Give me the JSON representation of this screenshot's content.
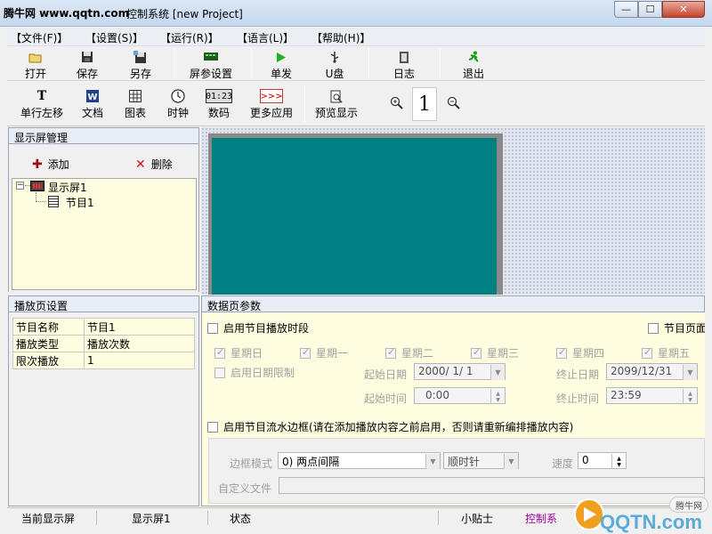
{
  "window": {
    "brand": "腾牛网 www.qqtn.com",
    "title": "控制系统 [new Project]",
    "min_symbol": "—",
    "max_symbol": "☐",
    "close_symbol": "✕"
  },
  "menu": [
    {
      "label": "【文件(F)】"
    },
    {
      "label": "【设置(S)】"
    },
    {
      "label": "【运行(R)】"
    },
    {
      "label": "【语言(L)】"
    },
    {
      "label": "【帮助(H)】"
    }
  ],
  "toolbar1": [
    {
      "label": "打开",
      "icon": "folder-open-icon"
    },
    {
      "label": "保存",
      "icon": "floppy-disk-icon"
    },
    {
      "label": "另存",
      "icon": "save-as-icon"
    },
    {
      "label": "屏参设置",
      "icon": "screen-settings-icon"
    },
    {
      "label": "单发",
      "icon": "play-icon"
    },
    {
      "label": "U盘",
      "icon": "usb-icon"
    },
    {
      "label": "日志",
      "icon": "log-icon"
    },
    {
      "label": "退出",
      "icon": "exit-runner-icon"
    }
  ],
  "toolbar2": [
    {
      "label": "单行左移",
      "icon": "text-t-icon"
    },
    {
      "label": "文档",
      "icon": "word-doc-icon"
    },
    {
      "label": "图表",
      "icon": "table-icon"
    },
    {
      "label": "时钟",
      "icon": "clock-icon"
    },
    {
      "label": "数码",
      "icon": "digital-01-23-icon"
    },
    {
      "label": "更多应用",
      "icon": "more-arrows-icon"
    },
    {
      "label": "预览显示",
      "icon": "preview-icon"
    }
  ],
  "zoom": {
    "value": "1"
  },
  "screen_mgr": {
    "title": "显示屏管理",
    "add_label": "添加",
    "delete_label": "删除",
    "tree_root": "显示屏1",
    "tree_child": "节目1"
  },
  "play_page": {
    "title": "播放页设置",
    "rows": [
      {
        "key": "节目名称",
        "value": "节目1"
      },
      {
        "key": "播放类型",
        "value": "播放次数"
      },
      {
        "key": "限次播放",
        "value": "1"
      }
    ]
  },
  "data_page": {
    "title": "数据页参数",
    "enable_period": "启用节目播放时段",
    "page_flip": "节目页面",
    "weekdays": [
      "星期日",
      "星期一",
      "星期二",
      "星期三",
      "星期四",
      "星期五"
    ],
    "enable_date_limit": "启用日期限制",
    "start_date_label": "起始日期",
    "start_date": "2000/ 1/ 1",
    "end_date_label": "终止日期",
    "end_date": "2099/12/31",
    "start_time_label": "起始时间",
    "start_time": "0:00",
    "end_time_label": "终止时间",
    "end_time": "23:59",
    "enable_border": "启用节目流水边框(请在添加播放内容之前启用，否则请重新编排播放内容)",
    "border_mode_label": "边框模式",
    "border_mode": "0) 两点间隔",
    "direction": "顺时针",
    "speed_label": "速度",
    "speed": "0",
    "custom_file_label": "自定义文件"
  },
  "status": {
    "current_label": "当前显示屏",
    "current_value": "显示屏1",
    "state_label": "状态",
    "tip_label": "小贴士",
    "tip_text": "控制系"
  },
  "watermark": {
    "brand": "腾牛网",
    "site": "QQTN.com"
  }
}
